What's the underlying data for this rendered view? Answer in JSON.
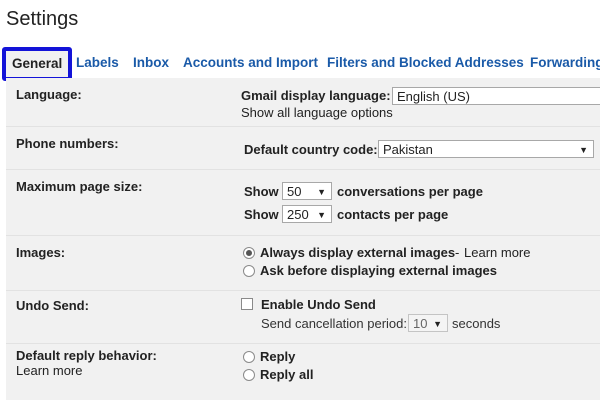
{
  "page": {
    "title": "Settings"
  },
  "tabs": [
    {
      "label": "General"
    },
    {
      "label": "Labels"
    },
    {
      "label": "Inbox"
    },
    {
      "label": "Accounts and Import"
    },
    {
      "label": "Filters and Blocked Addresses"
    },
    {
      "label": "Forwarding"
    }
  ],
  "language": {
    "label": "Language:",
    "display_label": "Gmail display language:",
    "display_value": "English (US)",
    "show_all_link": "Show all language options"
  },
  "phone": {
    "label": "Phone numbers:",
    "country_label": "Default country code:",
    "country_value": "Pakistan"
  },
  "page_size": {
    "label": "Maximum page size:",
    "show_label": "Show",
    "conversations_value": "50",
    "conversations_suffix": "conversations per page",
    "contacts_value": "250",
    "contacts_suffix": "contacts per page"
  },
  "images": {
    "label": "Images:",
    "option_always": "Always display external images",
    "separator": "-",
    "learn_more": "Learn more",
    "option_ask": "Ask before displaying external images",
    "selected": "always"
  },
  "undo_send": {
    "label": "Undo Send:",
    "enable_label": "Enable Undo Send",
    "enabled": false,
    "period_label": "Send cancellation period:",
    "period_value": "10",
    "period_suffix": "seconds"
  },
  "reply": {
    "label": "Default reply behavior:",
    "learn_more": "Learn more",
    "option_reply": "Reply",
    "option_reply_all": "Reply all"
  },
  "colors": {
    "link": "#1a5aa8",
    "highlight": "#1313d8",
    "panel": "#f1f1f1"
  }
}
